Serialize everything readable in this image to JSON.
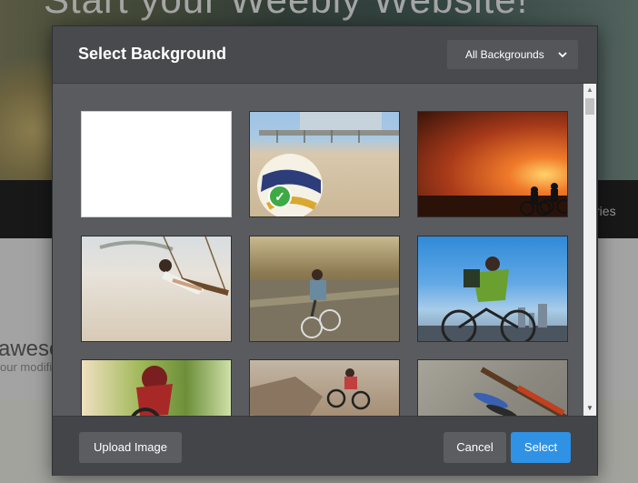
{
  "background_page": {
    "hero_title": "Start your Weebly Website!",
    "nav_link": "Stories",
    "content_heading": "awesome",
    "content_sub": "our modifie"
  },
  "modal": {
    "title": "Select Background",
    "filter": {
      "selected": "All Backgrounds",
      "icon": "chevron-down-icon"
    },
    "thumbnails": [
      {
        "name": "blank-white",
        "selected": true
      },
      {
        "name": "beach-volleyball",
        "selected": false
      },
      {
        "name": "sunset-cyclists",
        "selected": false
      },
      {
        "name": "beach-swing",
        "selected": false
      },
      {
        "name": "road-cyclist",
        "selected": false
      },
      {
        "name": "sky-cyclist",
        "selected": false
      },
      {
        "name": "mountain-biker-trees",
        "selected": false
      },
      {
        "name": "rocky-biker",
        "selected": false
      },
      {
        "name": "fishing-gear",
        "selected": false
      }
    ],
    "buttons": {
      "upload": "Upload Image",
      "cancel": "Cancel",
      "select": "Select"
    },
    "colors": {
      "accent": "#2f92e5",
      "check": "#3eaa45"
    }
  }
}
